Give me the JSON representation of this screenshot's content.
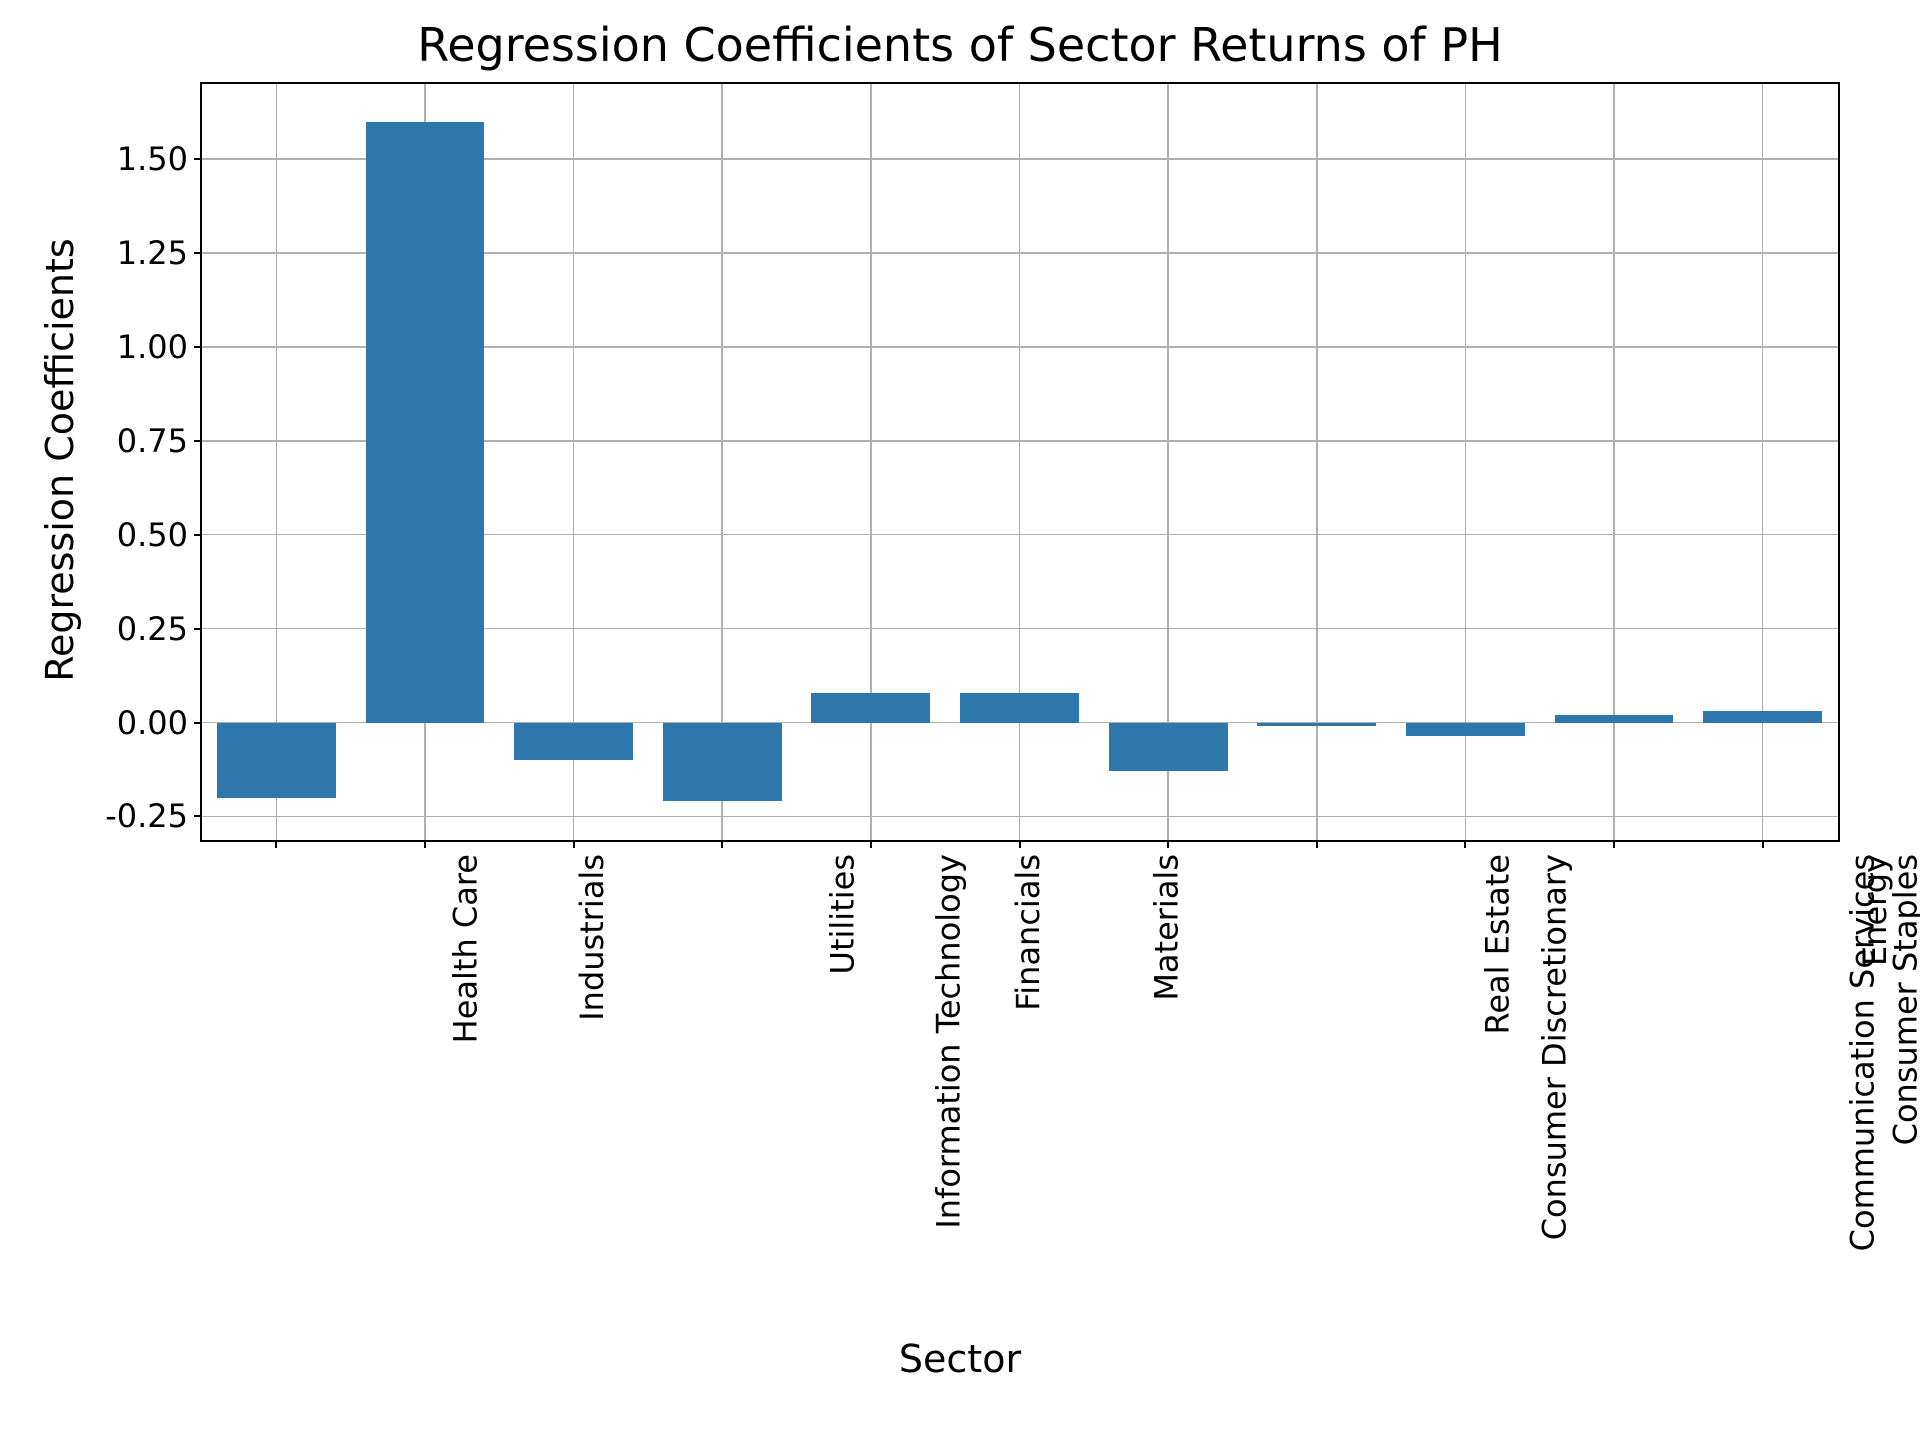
{
  "chart_data": {
    "type": "bar",
    "title": "Regression Coefficients of Sector Returns of PH",
    "xlabel": "Sector",
    "ylabel": "Regression Coefficients",
    "categories": [
      "Health Care",
      "Industrials",
      "Information Technology",
      "Utilities",
      "Financials",
      "Materials",
      "Consumer Discretionary",
      "Real Estate",
      "Communication Services",
      "Consumer Staples",
      "Energy"
    ],
    "values": [
      -0.2,
      1.6,
      -0.1,
      -0.21,
      0.08,
      0.08,
      -0.13,
      -0.01,
      -0.035,
      0.02,
      0.03
    ],
    "ylim": [
      -0.31,
      1.7
    ],
    "yticks": [
      -0.25,
      0.0,
      0.25,
      0.5,
      0.75,
      1.0,
      1.25,
      1.5
    ],
    "bar_color": "#2e77ac",
    "grid": true
  }
}
